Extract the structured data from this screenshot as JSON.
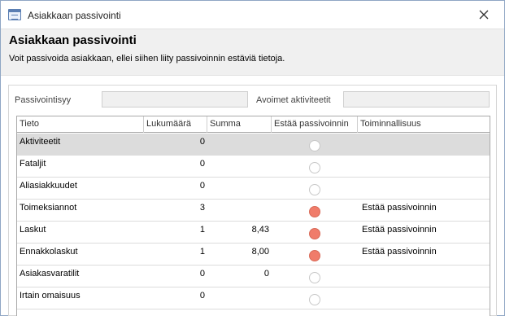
{
  "window": {
    "title": "Asiakkaan passivointi"
  },
  "header": {
    "title": "Asiakkaan passivointi",
    "description": "Voit passivoida asiakkaan, ellei siihen liity passivoinnin estäviä tietoja."
  },
  "fields": {
    "passivointisyy_label": "Passivointisyy",
    "passivointisyy_value": "",
    "avoimet_label": "Avoimet aktiviteetit",
    "avoimet_value": ""
  },
  "grid": {
    "columns": [
      "Tieto",
      "Lukumäärä",
      "Summa",
      "Estää passivoinnin",
      "Toiminnallisuus"
    ],
    "rows": [
      {
        "tieto": "Aktiviteetit",
        "lukumaara": "0",
        "summa": "",
        "estaa": false,
        "toiminnallisuus": "",
        "selected": true
      },
      {
        "tieto": "Fataljit",
        "lukumaara": "0",
        "summa": "",
        "estaa": false,
        "toiminnallisuus": ""
      },
      {
        "tieto": "Aliasiakkuudet",
        "lukumaara": "0",
        "summa": "",
        "estaa": false,
        "toiminnallisuus": ""
      },
      {
        "tieto": "Toimeksiannot",
        "lukumaara": "3",
        "summa": "",
        "estaa": true,
        "toiminnallisuus": "Estää passivoinnin"
      },
      {
        "tieto": "Laskut",
        "lukumaara": "1",
        "summa": "8,43",
        "estaa": true,
        "toiminnallisuus": "Estää passivoinnin"
      },
      {
        "tieto": "Ennakkolaskut",
        "lukumaara": "1",
        "summa": "8,00",
        "estaa": true,
        "toiminnallisuus": "Estää passivoinnin"
      },
      {
        "tieto": "Asiakasvaratilit",
        "lukumaara": "0",
        "summa": "0",
        "estaa": false,
        "toiminnallisuus": ""
      },
      {
        "tieto": "Irtain omaisuus",
        "lukumaara": "0",
        "summa": "",
        "estaa": false,
        "toiminnallisuus": ""
      }
    ]
  },
  "colors": {
    "blocked": "#f07c6a",
    "header_bg": "#f0f0f0",
    "selected_row": "#dcdcdc"
  }
}
